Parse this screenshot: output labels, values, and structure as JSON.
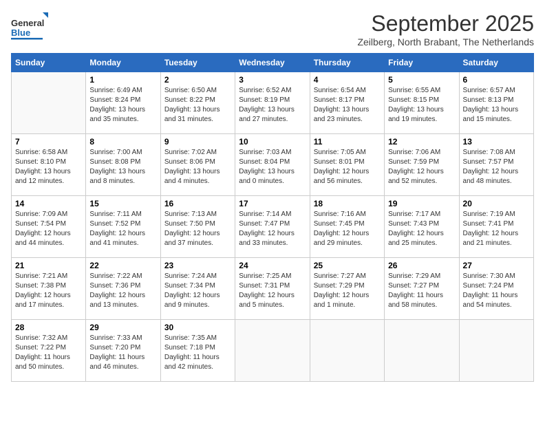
{
  "logo": {
    "general": "General",
    "blue": "Blue"
  },
  "header": {
    "title": "September 2025",
    "location": "Zeilberg, North Brabant, The Netherlands"
  },
  "weekdays": [
    "Sunday",
    "Monday",
    "Tuesday",
    "Wednesday",
    "Thursday",
    "Friday",
    "Saturday"
  ],
  "weeks": [
    [
      {
        "day": "",
        "sunrise": "",
        "sunset": "",
        "daylight": ""
      },
      {
        "day": "1",
        "sunrise": "Sunrise: 6:49 AM",
        "sunset": "Sunset: 8:24 PM",
        "daylight": "Daylight: 13 hours and 35 minutes."
      },
      {
        "day": "2",
        "sunrise": "Sunrise: 6:50 AM",
        "sunset": "Sunset: 8:22 PM",
        "daylight": "Daylight: 13 hours and 31 minutes."
      },
      {
        "day": "3",
        "sunrise": "Sunrise: 6:52 AM",
        "sunset": "Sunset: 8:19 PM",
        "daylight": "Daylight: 13 hours and 27 minutes."
      },
      {
        "day": "4",
        "sunrise": "Sunrise: 6:54 AM",
        "sunset": "Sunset: 8:17 PM",
        "daylight": "Daylight: 13 hours and 23 minutes."
      },
      {
        "day": "5",
        "sunrise": "Sunrise: 6:55 AM",
        "sunset": "Sunset: 8:15 PM",
        "daylight": "Daylight: 13 hours and 19 minutes."
      },
      {
        "day": "6",
        "sunrise": "Sunrise: 6:57 AM",
        "sunset": "Sunset: 8:13 PM",
        "daylight": "Daylight: 13 hours and 15 minutes."
      }
    ],
    [
      {
        "day": "7",
        "sunrise": "Sunrise: 6:58 AM",
        "sunset": "Sunset: 8:10 PM",
        "daylight": "Daylight: 13 hours and 12 minutes."
      },
      {
        "day": "8",
        "sunrise": "Sunrise: 7:00 AM",
        "sunset": "Sunset: 8:08 PM",
        "daylight": "Daylight: 13 hours and 8 minutes."
      },
      {
        "day": "9",
        "sunrise": "Sunrise: 7:02 AM",
        "sunset": "Sunset: 8:06 PM",
        "daylight": "Daylight: 13 hours and 4 minutes."
      },
      {
        "day": "10",
        "sunrise": "Sunrise: 7:03 AM",
        "sunset": "Sunset: 8:04 PM",
        "daylight": "Daylight: 13 hours and 0 minutes."
      },
      {
        "day": "11",
        "sunrise": "Sunrise: 7:05 AM",
        "sunset": "Sunset: 8:01 PM",
        "daylight": "Daylight: 12 hours and 56 minutes."
      },
      {
        "day": "12",
        "sunrise": "Sunrise: 7:06 AM",
        "sunset": "Sunset: 7:59 PM",
        "daylight": "Daylight: 12 hours and 52 minutes."
      },
      {
        "day": "13",
        "sunrise": "Sunrise: 7:08 AM",
        "sunset": "Sunset: 7:57 PM",
        "daylight": "Daylight: 12 hours and 48 minutes."
      }
    ],
    [
      {
        "day": "14",
        "sunrise": "Sunrise: 7:09 AM",
        "sunset": "Sunset: 7:54 PM",
        "daylight": "Daylight: 12 hours and 44 minutes."
      },
      {
        "day": "15",
        "sunrise": "Sunrise: 7:11 AM",
        "sunset": "Sunset: 7:52 PM",
        "daylight": "Daylight: 12 hours and 41 minutes."
      },
      {
        "day": "16",
        "sunrise": "Sunrise: 7:13 AM",
        "sunset": "Sunset: 7:50 PM",
        "daylight": "Daylight: 12 hours and 37 minutes."
      },
      {
        "day": "17",
        "sunrise": "Sunrise: 7:14 AM",
        "sunset": "Sunset: 7:47 PM",
        "daylight": "Daylight: 12 hours and 33 minutes."
      },
      {
        "day": "18",
        "sunrise": "Sunrise: 7:16 AM",
        "sunset": "Sunset: 7:45 PM",
        "daylight": "Daylight: 12 hours and 29 minutes."
      },
      {
        "day": "19",
        "sunrise": "Sunrise: 7:17 AM",
        "sunset": "Sunset: 7:43 PM",
        "daylight": "Daylight: 12 hours and 25 minutes."
      },
      {
        "day": "20",
        "sunrise": "Sunrise: 7:19 AM",
        "sunset": "Sunset: 7:41 PM",
        "daylight": "Daylight: 12 hours and 21 minutes."
      }
    ],
    [
      {
        "day": "21",
        "sunrise": "Sunrise: 7:21 AM",
        "sunset": "Sunset: 7:38 PM",
        "daylight": "Daylight: 12 hours and 17 minutes."
      },
      {
        "day": "22",
        "sunrise": "Sunrise: 7:22 AM",
        "sunset": "Sunset: 7:36 PM",
        "daylight": "Daylight: 12 hours and 13 minutes."
      },
      {
        "day": "23",
        "sunrise": "Sunrise: 7:24 AM",
        "sunset": "Sunset: 7:34 PM",
        "daylight": "Daylight: 12 hours and 9 minutes."
      },
      {
        "day": "24",
        "sunrise": "Sunrise: 7:25 AM",
        "sunset": "Sunset: 7:31 PM",
        "daylight": "Daylight: 12 hours and 5 minutes."
      },
      {
        "day": "25",
        "sunrise": "Sunrise: 7:27 AM",
        "sunset": "Sunset: 7:29 PM",
        "daylight": "Daylight: 12 hours and 1 minute."
      },
      {
        "day": "26",
        "sunrise": "Sunrise: 7:29 AM",
        "sunset": "Sunset: 7:27 PM",
        "daylight": "Daylight: 11 hours and 58 minutes."
      },
      {
        "day": "27",
        "sunrise": "Sunrise: 7:30 AM",
        "sunset": "Sunset: 7:24 PM",
        "daylight": "Daylight: 11 hours and 54 minutes."
      }
    ],
    [
      {
        "day": "28",
        "sunrise": "Sunrise: 7:32 AM",
        "sunset": "Sunset: 7:22 PM",
        "daylight": "Daylight: 11 hours and 50 minutes."
      },
      {
        "day": "29",
        "sunrise": "Sunrise: 7:33 AM",
        "sunset": "Sunset: 7:20 PM",
        "daylight": "Daylight: 11 hours and 46 minutes."
      },
      {
        "day": "30",
        "sunrise": "Sunrise: 7:35 AM",
        "sunset": "Sunset: 7:18 PM",
        "daylight": "Daylight: 11 hours and 42 minutes."
      },
      {
        "day": "",
        "sunrise": "",
        "sunset": "",
        "daylight": ""
      },
      {
        "day": "",
        "sunrise": "",
        "sunset": "",
        "daylight": ""
      },
      {
        "day": "",
        "sunrise": "",
        "sunset": "",
        "daylight": ""
      },
      {
        "day": "",
        "sunrise": "",
        "sunset": "",
        "daylight": ""
      }
    ]
  ]
}
